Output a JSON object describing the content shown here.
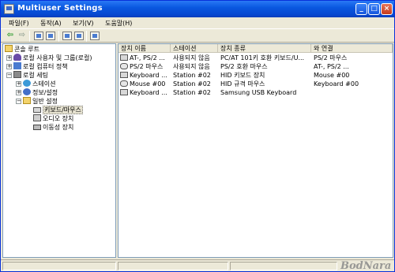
{
  "window": {
    "title": "Multiuser Settings"
  },
  "menu": [
    "파일(F)",
    "동작(A)",
    "보기(V)",
    "도움말(H)"
  ],
  "toolbar": {
    "back": "⇦",
    "forward": "⇨"
  },
  "tree": {
    "root": "콘솔 루트",
    "local_users_groups": "로컬 사용자 및 그룹(로컬)",
    "local_security_policy": "로컬 컴퓨터 정책",
    "local_settings": "로컬 세팅",
    "station": "스테이션",
    "info_settings": "정보/설정",
    "general_settings": "일반 설정",
    "keyboard_mouse": "키보드/마우스",
    "audio_device": "오디오 장치",
    "storage_device": "이동성 장치"
  },
  "list": {
    "columns": [
      "장치 이름",
      "스테이션",
      "장치 종류",
      "와 연결"
    ],
    "rows": [
      {
        "icon": "keyboard-icon",
        "name": "AT-, PS/2 ...",
        "station": "사용되지 않음",
        "type": "PC/AT 101키 호환 키보드/U...",
        "connected": "PS/2 마우스"
      },
      {
        "icon": "mouse-icon",
        "name": "PS/2 마우스",
        "station": "사용되지 않음",
        "type": "PS/2 호환 마우스",
        "connected": "AT-, PS/2 ..."
      },
      {
        "icon": "keyboard-icon",
        "name": "Keyboard ...",
        "station": "Station #02",
        "type": "HID 키보드 장치",
        "connected": "Mouse #00"
      },
      {
        "icon": "mouse-icon",
        "name": "Mouse #00",
        "station": "Station #02",
        "type": "HID 규격 마우스",
        "connected": "Keyboard #00"
      },
      {
        "icon": "keyboard-icon",
        "name": "Keyboard ...",
        "station": "Station #02",
        "type": "Samsung USB Keyboard",
        "connected": ""
      }
    ]
  },
  "watermark": "BodNara"
}
